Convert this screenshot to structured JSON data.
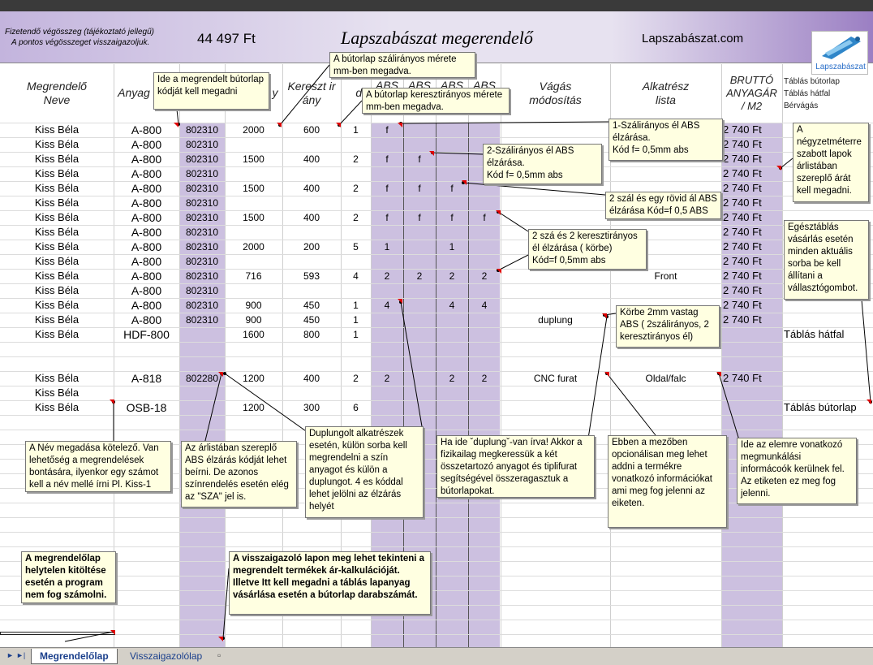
{
  "header": {
    "note_line1": "Fizetendő végösszeg (tájékoztató jellegű)",
    "note_line2": "A pontos végösszeget visszaigazoljuk.",
    "total": "44 497 Ft",
    "title": "Lapszabászat megerendelő",
    "site": "Lapszabászat.com",
    "logo_label": "Lapszabászat"
  },
  "columns": {
    "name": "Megrendelő\nNeve",
    "material": "Anyag",
    "code": "",
    "length": "y",
    "width": "Kereszt ir\nány",
    "qty": "db",
    "abs1": "ABS",
    "abs2": "ABS",
    "abs3": "ABS",
    "abs4": "ABS",
    "cut": "Vágás\nmódosítás",
    "part": "Alkatrész\nlista",
    "price": "BRUTTÓ\nANYAGÁR\n/ M2",
    "side1": "Táblás bútorlap",
    "side2": "Táblás hátfal",
    "side3": "Bérvágás"
  },
  "rows": [
    {
      "name": "Kiss Béla",
      "mat": "A-800",
      "code": "802310",
      "len": "2000",
      "wid": "600",
      "qty": "1",
      "a1": "f",
      "a2": "",
      "a3": "",
      "a4": "",
      "cut": "",
      "part": "",
      "price": "2 740 Ft"
    },
    {
      "name": "Kiss Béla",
      "mat": "A-800",
      "code": "802310",
      "len": "",
      "wid": "",
      "qty": "",
      "a1": "",
      "a2": "",
      "a3": "",
      "a4": "",
      "cut": "",
      "part": "",
      "price": "2 740 Ft"
    },
    {
      "name": "Kiss Béla",
      "mat": "A-800",
      "code": "802310",
      "len": "1500",
      "wid": "400",
      "qty": "2",
      "a1": "f",
      "a2": "f",
      "a3": "",
      "a4": "",
      "cut": "",
      "part": "",
      "price": "2 740 Ft"
    },
    {
      "name": "Kiss Béla",
      "mat": "A-800",
      "code": "802310",
      "len": "",
      "wid": "",
      "qty": "",
      "a1": "",
      "a2": "",
      "a3": "",
      "a4": "",
      "cut": "",
      "part": "",
      "price": "2 740 Ft"
    },
    {
      "name": "Kiss Béla",
      "mat": "A-800",
      "code": "802310",
      "len": "1500",
      "wid": "400",
      "qty": "2",
      "a1": "f",
      "a2": "f",
      "a3": "f",
      "a4": "",
      "cut": "",
      "part": "",
      "price": "2 740 Ft"
    },
    {
      "name": "Kiss Béla",
      "mat": "A-800",
      "code": "802310",
      "len": "",
      "wid": "",
      "qty": "",
      "a1": "",
      "a2": "",
      "a3": "",
      "a4": "",
      "cut": "",
      "part": "",
      "price": "2 740 Ft"
    },
    {
      "name": "Kiss Béla",
      "mat": "A-800",
      "code": "802310",
      "len": "1500",
      "wid": "400",
      "qty": "2",
      "a1": "f",
      "a2": "f",
      "a3": "f",
      "a4": "f",
      "cut": "",
      "part": "",
      "price": "2 740 Ft"
    },
    {
      "name": "Kiss Béla",
      "mat": "A-800",
      "code": "802310",
      "len": "",
      "wid": "",
      "qty": "",
      "a1": "",
      "a2": "",
      "a3": "",
      "a4": "",
      "cut": "",
      "part": "",
      "price": "2 740 Ft"
    },
    {
      "name": "Kiss Béla",
      "mat": "A-800",
      "code": "802310",
      "len": "2000",
      "wid": "200",
      "qty": "5",
      "a1": "1",
      "a2": "",
      "a3": "1",
      "a4": "",
      "cut": "",
      "part": "",
      "price": "2 740 Ft"
    },
    {
      "name": "Kiss Béla",
      "mat": "A-800",
      "code": "802310",
      "len": "",
      "wid": "",
      "qty": "",
      "a1": "",
      "a2": "",
      "a3": "",
      "a4": "",
      "cut": "",
      "part": "",
      "price": "2 740 Ft"
    },
    {
      "name": "Kiss Béla",
      "mat": "A-800",
      "code": "802310",
      "len": "716",
      "wid": "593",
      "qty": "4",
      "a1": "2",
      "a2": "2",
      "a3": "2",
      "a4": "2",
      "cut": "",
      "part": "Front",
      "price": "2 740 Ft"
    },
    {
      "name": "Kiss Béla",
      "mat": "A-800",
      "code": "802310",
      "len": "",
      "wid": "",
      "qty": "",
      "a1": "",
      "a2": "",
      "a3": "",
      "a4": "",
      "cut": "",
      "part": "",
      "price": "2 740 Ft"
    },
    {
      "name": "Kiss Béla",
      "mat": "A-800",
      "code": "802310",
      "len": "900",
      "wid": "450",
      "qty": "1",
      "a1": "4",
      "a2": "",
      "a3": "4",
      "a4": "4",
      "cut": "",
      "part": "",
      "price": "2 740 Ft"
    },
    {
      "name": "Kiss Béla",
      "mat": "A-800",
      "code": "802310",
      "len": "900",
      "wid": "450",
      "qty": "1",
      "a1": "",
      "a2": "",
      "a3": "",
      "a4": "",
      "cut": "duplung",
      "part": "",
      "price": "2 740 Ft"
    },
    {
      "name": "Kiss Béla",
      "mat": "HDF-800",
      "code": "",
      "len": "1600",
      "wid": "800",
      "qty": "1",
      "a1": "",
      "a2": "",
      "a3": "",
      "a4": "",
      "cut": "",
      "part": "",
      "price": "",
      "side": "Táblás hátfal"
    },
    {
      "name": "",
      "mat": "",
      "code": "",
      "len": "",
      "wid": "",
      "qty": "",
      "a1": "",
      "a2": "",
      "a3": "",
      "a4": "",
      "cut": "",
      "part": "",
      "price": ""
    },
    {
      "name": "",
      "mat": "",
      "code": "",
      "len": "",
      "wid": "",
      "qty": "",
      "a1": "",
      "a2": "",
      "a3": "",
      "a4": "",
      "cut": "",
      "part": "",
      "price": ""
    },
    {
      "name": "Kiss Béla",
      "mat": "A-818",
      "code": "802280",
      "len": "1200",
      "wid": "400",
      "qty": "2",
      "a1": "2",
      "a2": "",
      "a3": "2",
      "a4": "2",
      "cut": "CNC furat",
      "part": "Oldal/falc",
      "price": "2 740 Ft"
    },
    {
      "name": "Kiss Béla",
      "mat": "",
      "code": "",
      "len": "",
      "wid": "",
      "qty": "",
      "a1": "",
      "a2": "",
      "a3": "",
      "a4": "",
      "cut": "",
      "part": "",
      "price": ""
    },
    {
      "name": "Kiss Béla",
      "mat": "OSB-18",
      "code": "",
      "len": "1200",
      "wid": "300",
      "qty": "6",
      "a1": "",
      "a2": "",
      "a3": "",
      "a4": "",
      "cut": "",
      "part": "",
      "price": "",
      "side": "Táblás bútorlap"
    }
  ],
  "notes": [
    {
      "id": "n-material-code",
      "text": "Ide a megrendelt bútorlap kódját kell megadni"
    },
    {
      "id": "n-grain-length",
      "text": "A bútorlap szálirányos mérete mm-ben megadva."
    },
    {
      "id": "n-cross-length",
      "text": "A bútorlap keresztirányos mérete mm-ben megadva."
    },
    {
      "id": "n-abs1",
      "text": "1-Szálirányos él ABS élzárása.\nKód f= 0,5mm abs"
    },
    {
      "id": "n-abs2",
      "text": "2-Szálirányos él ABS élzárása.\nKód f= 0,5mm abs"
    },
    {
      "id": "n-abs3",
      "text": "2 szál és egy rövid ál ABS élzárása Kód=f 0,5 ABS"
    },
    {
      "id": "n-abs4",
      "text": "2 szá és 2 keresztirányos él élzárása ( körbe)\nKód=f 0,5mm abs"
    },
    {
      "id": "n-round",
      "text": "Körbe 2mm vastag ABS ( 2szálirányos, 2 keresztirányos él)"
    },
    {
      "id": "n-price",
      "text": "A négyzetméterre szabott lapok árlistában szereplő árát kell megadni."
    },
    {
      "id": "n-whole-board",
      "text": "Egésztáblás vásárlás esetén minden aktuális sorba be kell állítani a vállasztógombot."
    },
    {
      "id": "n-name",
      "text": "A Név megadása kötelező. Van lehetőség a megrendelések bontására, ilyenkor egy számot kell a név mellé írni Pl. Kiss-1"
    },
    {
      "id": "n-abs-code",
      "text": "Az árlistában szereplő ABS élzárás kódját lehet beírni. De azonos színrendelés esetén elég az \"SZA\" jel is."
    },
    {
      "id": "n-duplung-parts",
      "text": "Duplungolt alkatrészek esetén, külön sorba kell megrendelni a szín anyagot és külön a duplungot. 4 es kóddal lehet jelölni az élzárás helyét"
    },
    {
      "id": "n-duplung-write",
      "text": "Ha ide ˇduplungˇ-van írva! Akkor a fizikailag megkeressük a két összetartozó anyagot és tiplifurat segítségével összeragasztuk a bútorlapokat."
    },
    {
      "id": "n-optional",
      "text": "Ebben a mezőben opcionálisan meg lehet addni a termékre vonatkozó információkat ami meg fog jelenni az eiketen."
    },
    {
      "id": "n-label",
      "text": "Ide az elemre vonatkozó megmunkálási informácoók kerülnek fel. Az etiketen ez meg fog jelenni."
    },
    {
      "id": "n-invalid",
      "text": "A megrendelőlap helytelen kitöltése esetén a program nem fog számolni."
    },
    {
      "id": "n-confirm",
      "text": "A visszaigazoló lapon meg lehet tekinteni a megrendelt termékek ár-kalkulációját. Illetve Itt kell megadni a táblás lapanyag vásárlása esetén a bútorlap darabszámát."
    }
  ],
  "tabs": {
    "order": "Megrendelőlap",
    "confirm": "Visszaigazolólap"
  },
  "colors": {
    "band": "#ccc0e0",
    "note_bg": "#ffffe1",
    "indicator": "#e00000"
  }
}
